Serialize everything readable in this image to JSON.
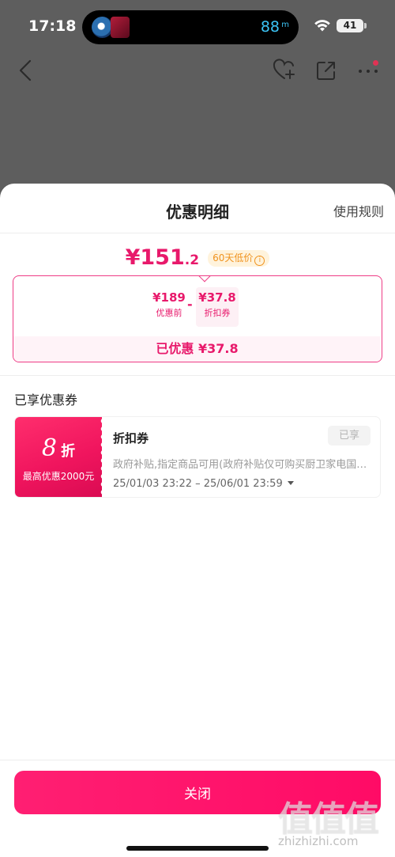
{
  "status_bar": {
    "time": "17:18",
    "island_value": "88",
    "island_unit": "m",
    "battery": "41"
  },
  "nav_icons": [
    "back-icon",
    "favorite-add-icon",
    "share-icon",
    "more-icon"
  ],
  "sheet": {
    "title": "优惠明细",
    "rules_link": "使用规则",
    "final_price_main": "¥151",
    "final_price_decimal": ".2",
    "low_price_badge": "60天低价",
    "calculation": {
      "original_value": "¥189",
      "original_label": "优惠前",
      "operator": "-",
      "discount_value": "¥37.8",
      "discount_label": "折扣券"
    },
    "saved_text": "已优惠 ¥37.8",
    "section_title": "已享优惠券",
    "coupon": {
      "discount_number": "8",
      "discount_unit": "折",
      "max_saving": "最高优惠2000元",
      "name": "折扣券",
      "status": "已享",
      "description": "政府补贴,指定商品可用(政府补贴仅可购买厨卫家电国家…",
      "validity": "25/01/03 23:22 – 25/06/01 23:59"
    },
    "close_button": "关闭"
  },
  "watermark": {
    "logo": "值值值",
    "url": "zhizhizhi.com"
  },
  "colors": {
    "accent": "#e8196b",
    "button": "#ff1469",
    "badge": "#f0931f"
  }
}
